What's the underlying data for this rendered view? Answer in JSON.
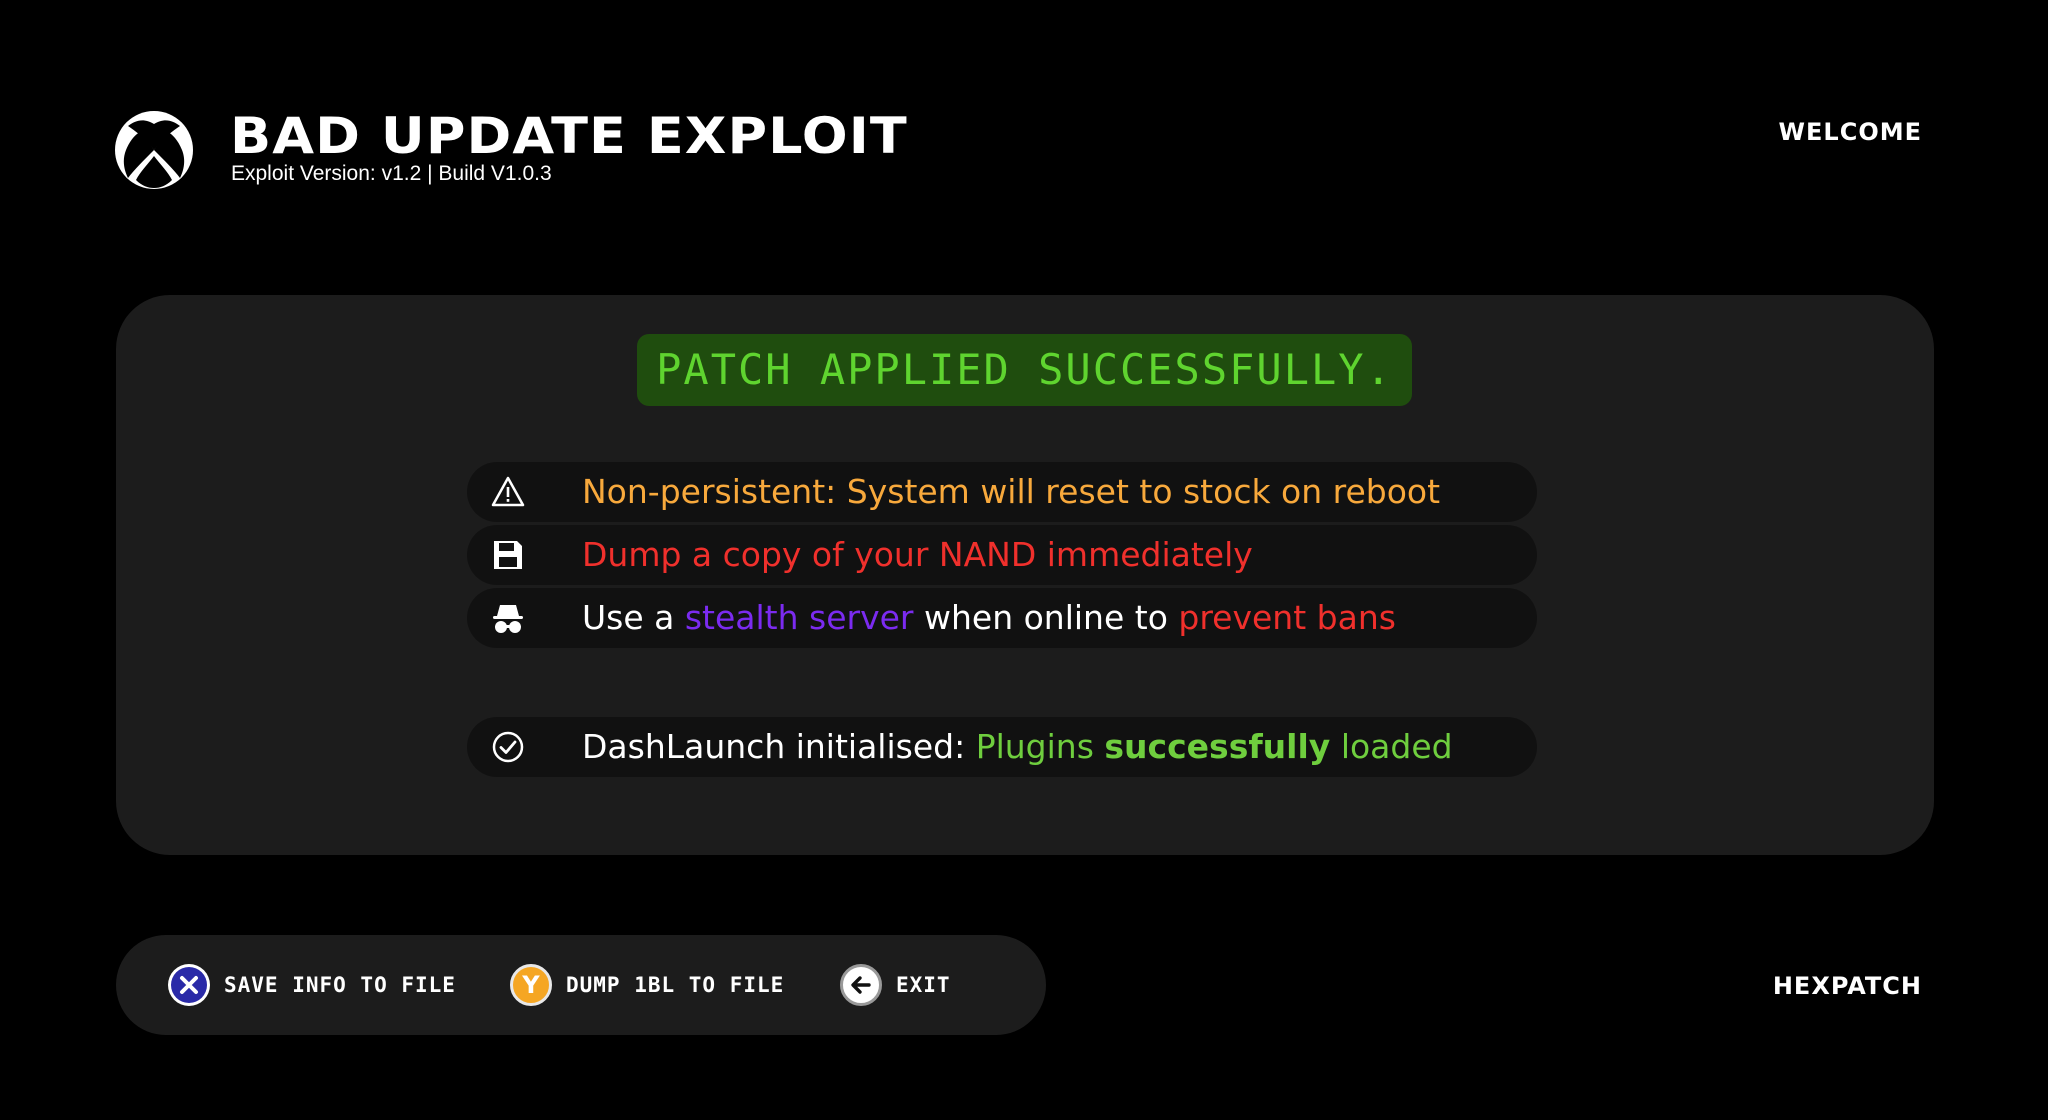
{
  "header": {
    "title": "BAD UPDATE EXPLOIT",
    "subtitle": "Exploit Version: v1.2 | Build V1.0.3",
    "welcome": "WELCOME",
    "logo_icon": "xbox-logo-icon"
  },
  "main": {
    "banner": "PATCH APPLIED SUCCESSFULLY.",
    "rows": [
      {
        "icon": "warning-icon",
        "segments": [
          {
            "text": "Non-persistent: System will reset to stock on reboot",
            "color": "#f8a93c"
          }
        ]
      },
      {
        "icon": "floppy-disk-icon",
        "segments": [
          {
            "text": "Dump a copy of your NAND immediately",
            "color": "#f0302c"
          }
        ]
      },
      {
        "icon": "incognito-icon",
        "segments": [
          {
            "text": "Use a ",
            "color": "#ffffff"
          },
          {
            "text": "stealth server",
            "color": "#7b2bf0"
          },
          {
            "text": " when online to ",
            "color": "#ffffff"
          },
          {
            "text": "prevent bans",
            "color": "#f0302c"
          }
        ]
      },
      {
        "icon": "check-circle-icon",
        "segments": [
          {
            "text": "DashLaunch initialised: ",
            "color": "#ffffff"
          },
          {
            "text": "Plugins ",
            "color": "#6fce3e"
          },
          {
            "text": "successfully",
            "color": "#6fce3e"
          },
          {
            "text": " loaded",
            "color": "#6fce3e"
          }
        ]
      }
    ]
  },
  "footer": {
    "buttons": [
      {
        "glyph": "X",
        "label": "SAVE INFO TO FILE",
        "icon": "x-button-icon"
      },
      {
        "glyph": "Y",
        "label": "DUMP 1BL TO FILE",
        "icon": "y-button-icon"
      },
      {
        "glyph": "",
        "label": "EXIT",
        "icon": "back-arrow-icon"
      }
    ],
    "brand": "HEXPATCH"
  },
  "colors": {
    "background": "#000000",
    "panel": "#1c1c1c",
    "banner_bg": "#1f4d0e",
    "banner_text": "#5fd42f"
  }
}
